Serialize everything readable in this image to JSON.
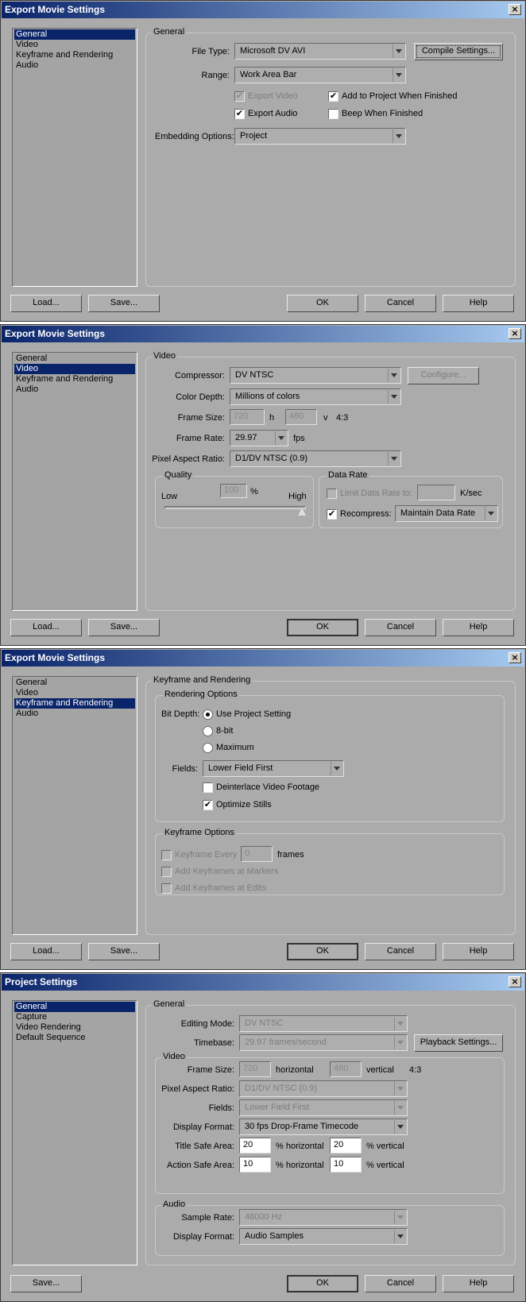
{
  "d1": {
    "title": "Export Movie Settings",
    "list": [
      "General",
      "Video",
      "Keyframe and Rendering",
      "Audio"
    ],
    "group": "General",
    "file_type_label": "File Type:",
    "file_type": "Microsoft DV AVI",
    "compile_settings": "Compile Settings...",
    "range_label": "Range:",
    "range": "Work Area Bar",
    "export_video": "Export Video",
    "add_to_project": "Add to Project When Finished",
    "export_audio": "Export Audio",
    "beep": "Beep When Finished",
    "embedding_label": "Embedding Options:",
    "embedding": "Project",
    "load": "Load...",
    "save": "Save...",
    "ok": "OK",
    "cancel": "Cancel",
    "help": "Help"
  },
  "d2": {
    "title": "Export Movie Settings",
    "list": [
      "General",
      "Video",
      "Keyframe and Rendering",
      "Audio"
    ],
    "group": "Video",
    "compressor_label": "Compressor:",
    "compressor": "DV NTSC",
    "configure": "Configure...",
    "color_depth_label": "Color Depth:",
    "color_depth": "Millions of colors",
    "frame_size_label": "Frame Size:",
    "frame_w": "720",
    "h": "h",
    "frame_h": "480",
    "v": "v",
    "aspect": "4:3",
    "frame_rate_label": "Frame Rate:",
    "frame_rate": "29.97",
    "fps": "fps",
    "par_label": "Pixel Aspect Ratio:",
    "par": "D1/DV NTSC (0.9)",
    "quality_group": "Quality",
    "low": "Low",
    "quality_value": "100",
    "percent": "%",
    "high": "High",
    "quality_level": 100,
    "data_rate_group": "Data Rate",
    "limit_data_rate": "Limit Data Rate to:",
    "ksec": "K/sec",
    "recompress": "Recompress:",
    "recompress_mode": "Maintain Data Rate",
    "load": "Load...",
    "save": "Save...",
    "ok": "OK",
    "cancel": "Cancel",
    "help": "Help"
  },
  "d3": {
    "title": "Export Movie Settings",
    "list": [
      "General",
      "Video",
      "Keyframe and Rendering",
      "Audio"
    ],
    "group": "Keyframe and Rendering",
    "rendering_group": "Rendering Options",
    "bit_depth_label": "Bit Depth:",
    "use_project": "Use Project Setting",
    "eight_bit": "8-bit",
    "maximum": "Maximum",
    "fields_label": "Fields:",
    "fields": "Lower Field First",
    "deinterlace": "Deinterlace Video Footage",
    "optimize_stills": "Optimize Stills",
    "keyframe_group": "Keyframe Options",
    "keyframe_every": "Keyframe Every",
    "keyframe_value": "0",
    "frames": "frames",
    "at_markers": "Add Keyframes at Markers",
    "at_edits": "Add Keyframes at Edits",
    "load": "Load...",
    "save": "Save...",
    "ok": "OK",
    "cancel": "Cancel",
    "help": "Help"
  },
  "d4": {
    "title": "Project Settings",
    "list": [
      "General",
      "Capture",
      "Video Rendering",
      "Default Sequence"
    ],
    "group": "General",
    "editing_mode_label": "Editing Mode:",
    "editing_mode": "DV NTSC",
    "timebase_label": "Timebase:",
    "timebase": "29.97 frames/second",
    "playback_settings": "Playback Settings...",
    "video_group": "Video",
    "frame_size_label": "Frame Size:",
    "frame_w": "720",
    "horizontal": "horizontal",
    "frame_h": "480",
    "vertical": "vertical",
    "aspect": "4:3",
    "par_label": "Pixel Aspect Ratio:",
    "par": "D1/DV NTSC (0.9)",
    "fields_label": "Fields:",
    "fields": "Lower Field First",
    "display_format_label": "Display Format:",
    "display_format": "30 fps Drop-Frame Timecode",
    "title_safe_label": "Title Safe Area:",
    "title_safe_h": "20",
    "title_safe_v": "20",
    "action_safe_label": "Action Safe Area:",
    "action_safe_h": "10",
    "action_safe_v": "10",
    "pct_horizontal": "% horizontal",
    "pct_vertical": "% vertical",
    "audio_group": "Audio",
    "sample_rate_label": "Sample Rate:",
    "sample_rate": "48000 Hz",
    "audio_display_label": "Display Format:",
    "audio_display": "Audio Samples",
    "save": "Save...",
    "ok": "OK",
    "cancel": "Cancel",
    "help": "Help"
  }
}
